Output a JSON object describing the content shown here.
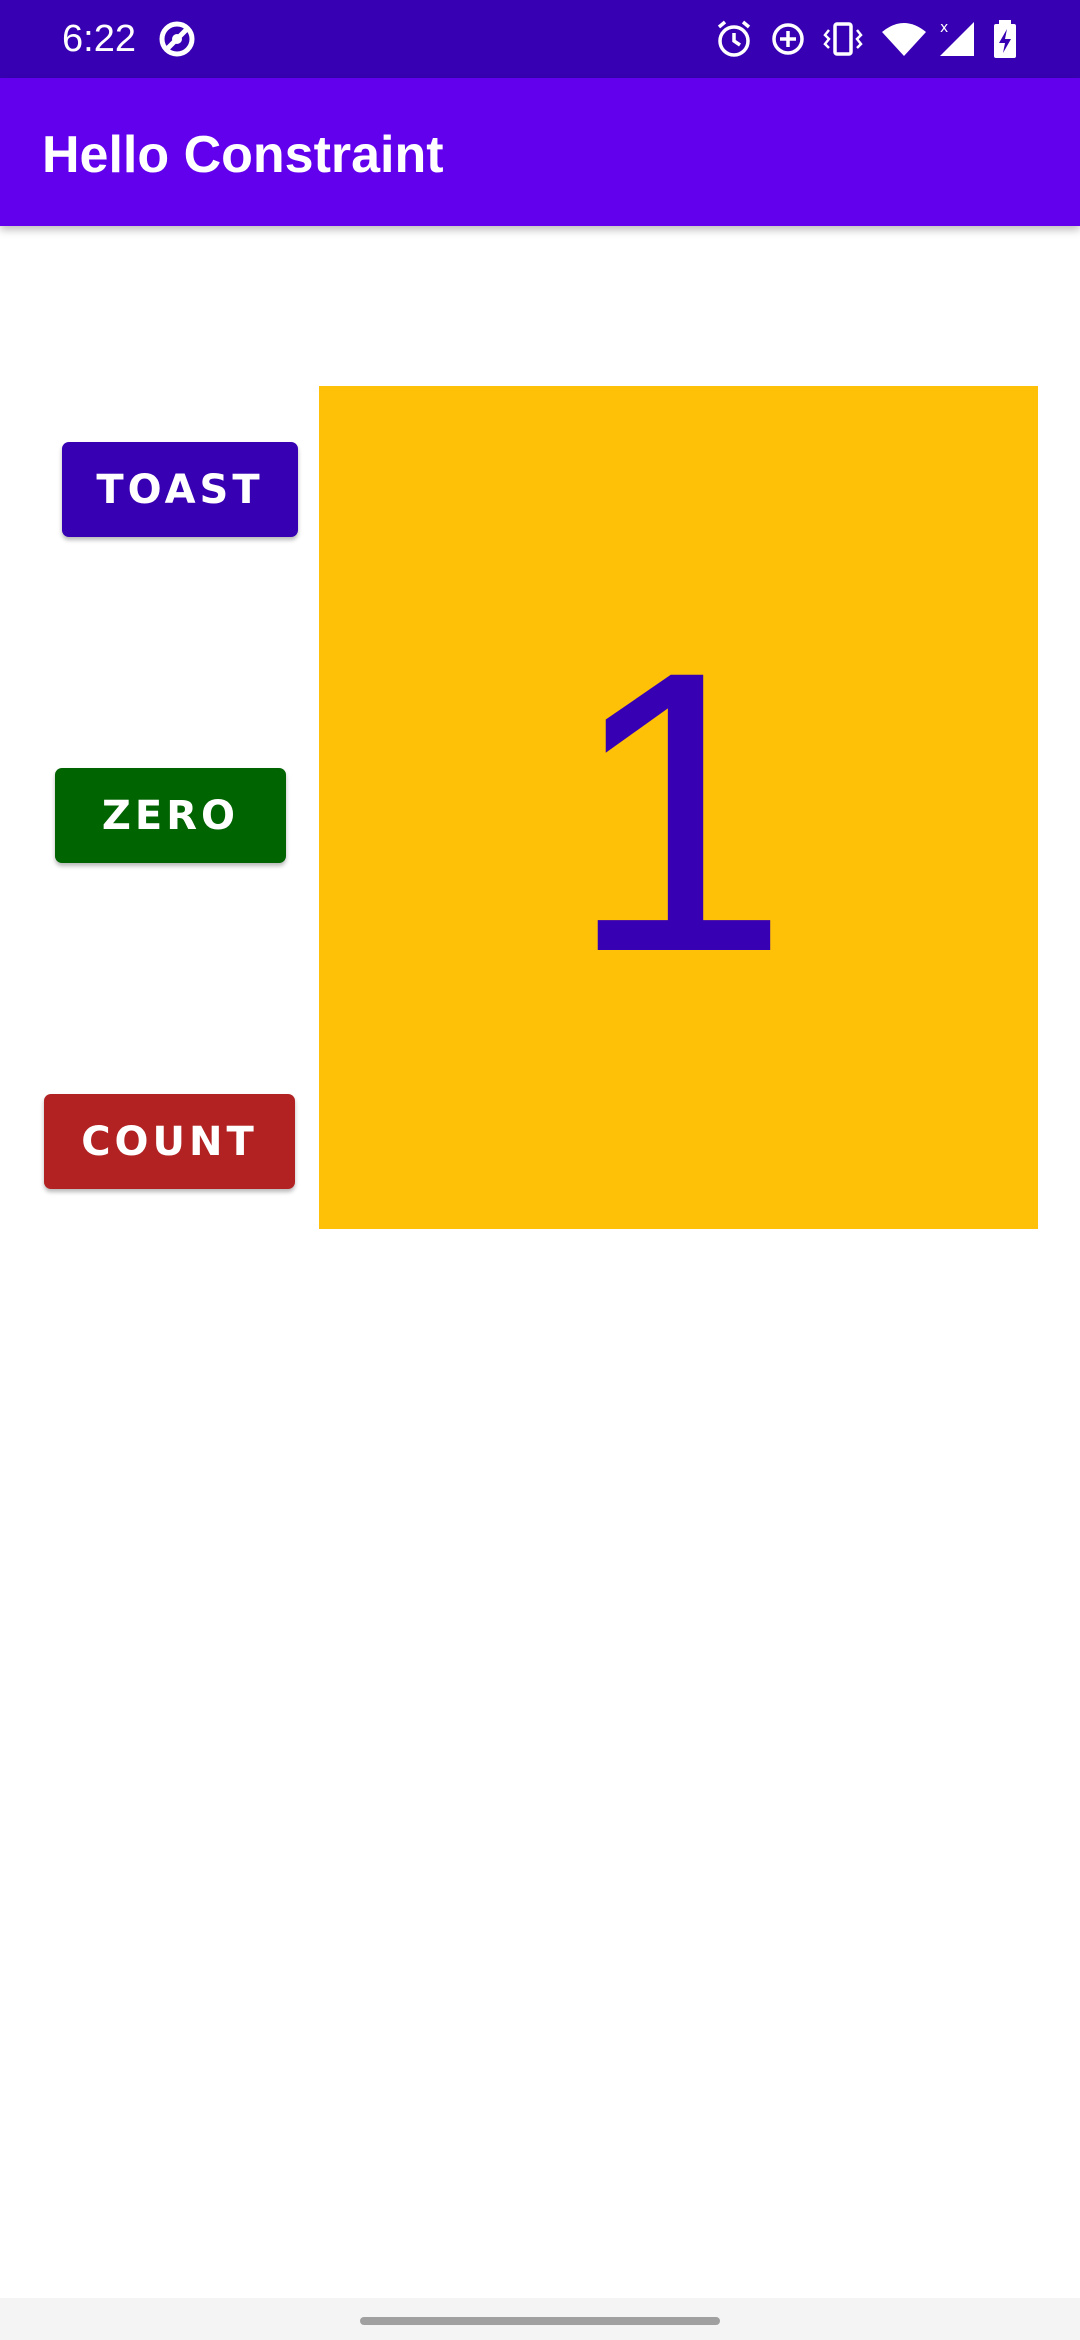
{
  "status_bar": {
    "time": "6:22",
    "icons": [
      "sync-icon",
      "alarm-icon",
      "data-saver-icon",
      "vibrate-icon",
      "wifi-icon",
      "signal-icon",
      "battery-icon"
    ]
  },
  "app_bar": {
    "title": "Hello Constraint"
  },
  "buttons": {
    "toast_label": "TOAST",
    "zero_label": "ZERO",
    "count_label": "COUNT"
  },
  "counter": {
    "value": "1"
  },
  "colors": {
    "status_bar": "#3700b3",
    "app_bar": "#6200ee",
    "toast_button": "#3700b3",
    "zero_button": "#006400",
    "count_button": "#b22222",
    "count_panel": "#ffc107",
    "count_text": "#3700b3"
  }
}
